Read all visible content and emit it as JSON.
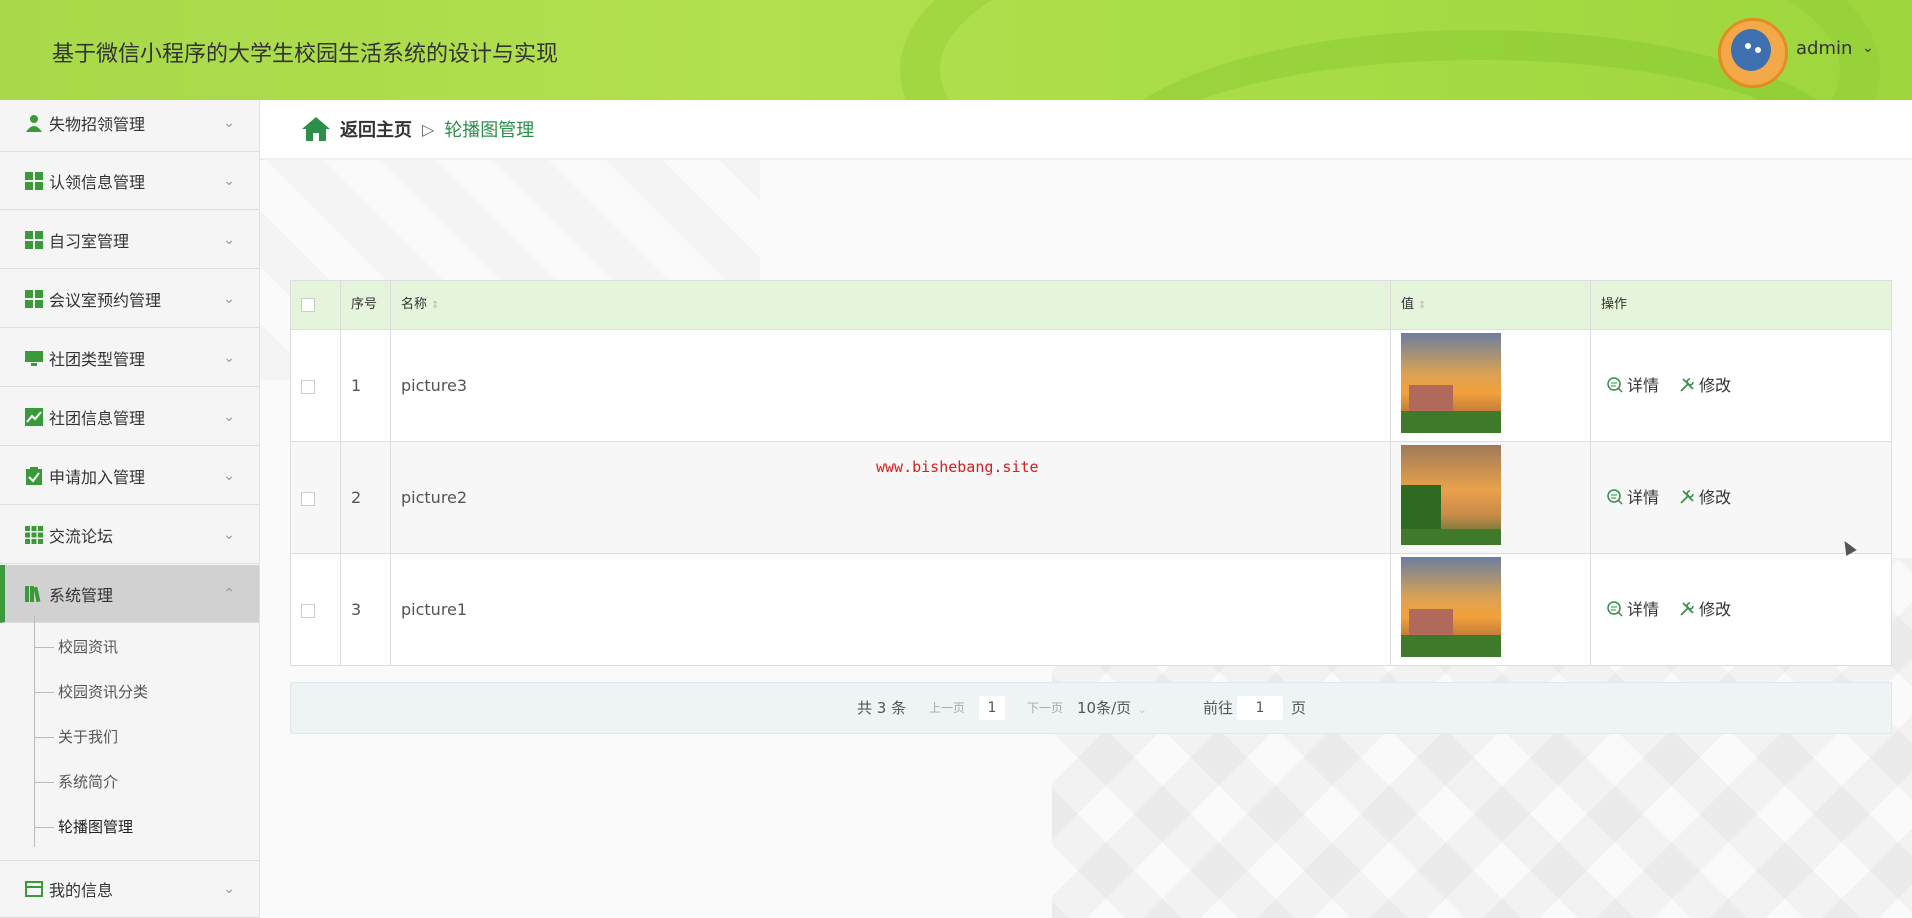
{
  "header": {
    "title": "基于微信小程序的大学生校园生活系统的设计与实现",
    "user": "admin"
  },
  "sidebar": {
    "items": [
      {
        "label": "失物招领管理",
        "icon": "user-icon"
      },
      {
        "label": "认领信息管理",
        "icon": "grid-icon"
      },
      {
        "label": "自习室管理",
        "icon": "grid-icon"
      },
      {
        "label": "会议室预约管理",
        "icon": "grid-icon"
      },
      {
        "label": "社团类型管理",
        "icon": "monitor-icon"
      },
      {
        "label": "社团信息管理",
        "icon": "chart-icon"
      },
      {
        "label": "申请加入管理",
        "icon": "clipboard-icon"
      },
      {
        "label": "交流论坛",
        "icon": "apps-icon"
      },
      {
        "label": "系统管理",
        "icon": "book-icon"
      },
      {
        "label": "我的信息",
        "icon": "card-icon"
      }
    ],
    "sub_items": [
      "校园资讯",
      "校园资讯分类",
      "关于我们",
      "系统简介",
      "轮播图管理"
    ]
  },
  "breadcrumb": {
    "home": "返回主页",
    "separator": "▷",
    "current": "轮播图管理"
  },
  "table": {
    "columns": [
      "序号",
      "名称",
      "值",
      "操作"
    ],
    "rows": [
      {
        "index": "1",
        "name": "picture3"
      },
      {
        "index": "2",
        "name": "picture2"
      },
      {
        "index": "3",
        "name": "picture1"
      }
    ],
    "actions": {
      "detail": "详情",
      "edit": "修改"
    }
  },
  "watermark": "www.bishebang.site",
  "pagination": {
    "total": "共 3 条",
    "prev": "上一页",
    "current_page": "1",
    "next": "下一页",
    "page_size": "10条/页",
    "goto_label": "前往",
    "goto_value": "1",
    "goto_suffix": "页"
  },
  "colors": {
    "header_green": "#a7d94a",
    "accent_green": "#2d8f4a",
    "table_head": "#e4f5dc"
  }
}
